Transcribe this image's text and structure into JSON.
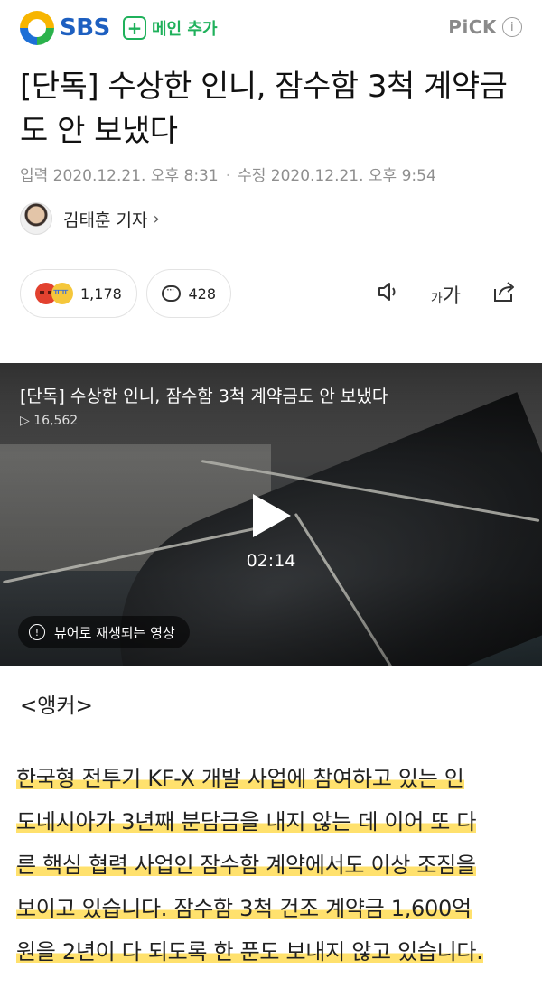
{
  "header": {
    "brand": "SBS",
    "main_add_label": "메인 추가",
    "pick_label": "PiCK",
    "info_label": "i"
  },
  "article": {
    "title": "[단독] 수상한 인니, 잠수함 3척 계약금도 안 보냈다",
    "published": "입력 2020.12.21. 오후 8:31",
    "modified": "수정 2020.12.21. 오후 9:54",
    "reporter": "김태훈 기자",
    "reporter_arrow": "›"
  },
  "actions": {
    "reaction_count": "1,178",
    "comment_count": "428",
    "font_size_small": "가",
    "font_size_large": "가"
  },
  "video": {
    "title": "[단독] 수상한 인니, 잠수함 3척 계약금도 안 보냈다",
    "views": "▷ 16,562",
    "duration": "02:14",
    "viewer_badge": "뷰어로 재생되는 영상"
  },
  "content": {
    "anchor": "<앵커>",
    "lines": [
      "한국형 전투기 KF-X 개발 사업에 참여하고 있는 인",
      "도네시아가 3년째 분담금을 내지 않는 데 이어 또 다",
      "른 핵심 협력 사업인 잠수함 계약에서도 이상 조짐을",
      "보이고 있습니다. 잠수함 3척 건조 계약금 1,600억",
      "원을 2년이 다 되도록 한 푼도 보내지 않고 있습니다."
    ]
  },
  "colors": {
    "brand_blue": "#1d5fc0",
    "green": "#1fb15b",
    "highlight": "#ffd73c"
  },
  "icons": [
    "sbs-logo-icon",
    "plus-icon",
    "info-icon",
    "angry-emoji-icon",
    "sad-emoji-icon",
    "comment-icon",
    "speaker-icon",
    "font-size-icon",
    "share-icon",
    "play-icon"
  ]
}
